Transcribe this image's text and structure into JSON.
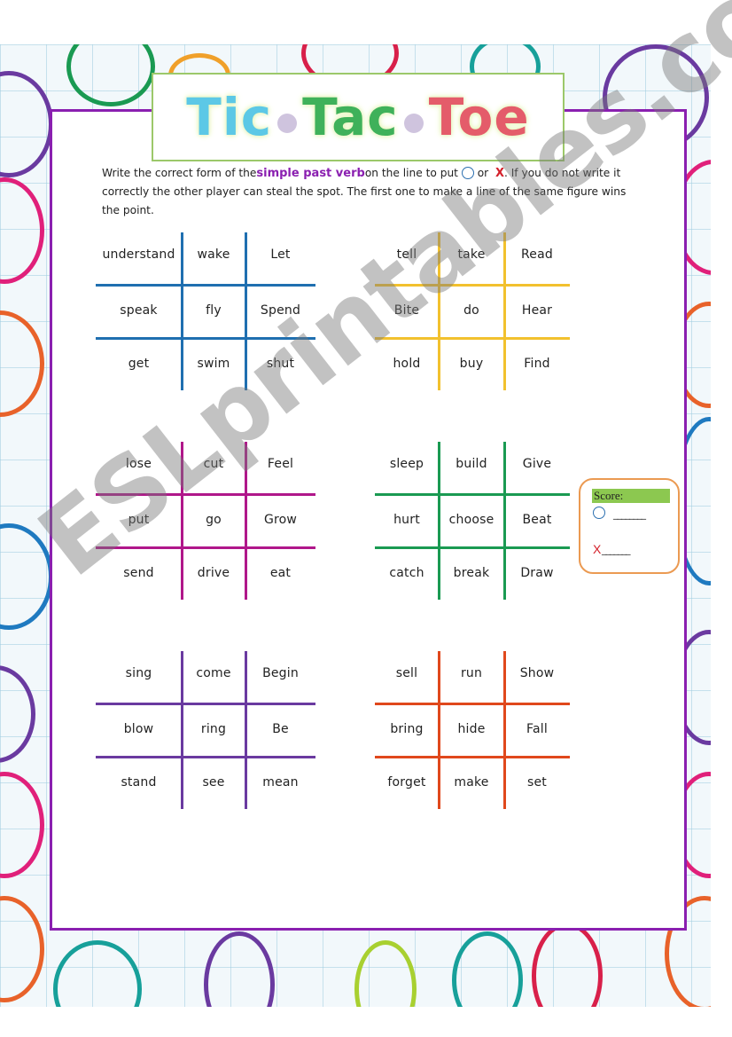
{
  "title": {
    "words": [
      "Tic",
      "Tac",
      "Toe"
    ]
  },
  "instructions": {
    "part1": "Write the correct form of the",
    "highlight": "simple past verb",
    "part2": "on the line to put",
    "or": "or",
    "x_symbol": "X",
    "part3": ". If you do not write it correctly the other player can steal the spot. The first one to make a line of the same figure wins the point."
  },
  "colors": {
    "frame": "#8a1fb0",
    "grid1": "#1f6fb0",
    "grid2": "#f2c12e",
    "grid3": "#b0178a",
    "grid4": "#1a9a52",
    "grid5": "#6a3aa0",
    "grid6": "#e0481c",
    "score_border": "#eb9a52",
    "score_label_bg": "#8cc850"
  },
  "grids": [
    {
      "name": "blue-grid",
      "cells": [
        "understand",
        "wake",
        "Let",
        "speak",
        "fly",
        "Spend",
        "get",
        "swim",
        "shut"
      ]
    },
    {
      "name": "yellow-grid",
      "cells": [
        "tell",
        "take",
        "Read",
        "Bite",
        "do",
        "Hear",
        "hold",
        "buy",
        "Find"
      ]
    },
    {
      "name": "magenta-grid",
      "cells": [
        "lose",
        "cut",
        "Feel",
        "put",
        "go",
        "Grow",
        "send",
        "drive",
        "eat"
      ]
    },
    {
      "name": "green-grid",
      "cells": [
        "sleep",
        "build",
        "Give",
        "hurt",
        "choose",
        "Beat",
        "catch",
        "break",
        "Draw"
      ]
    },
    {
      "name": "purple-grid",
      "cells": [
        "sing",
        "come",
        "Begin",
        "blow",
        "ring",
        "Be",
        "stand",
        "see",
        "mean"
      ]
    },
    {
      "name": "orange-grid",
      "cells": [
        "sell",
        "run",
        "Show",
        "bring",
        "hide",
        "Fall",
        "forget",
        "make",
        "set"
      ]
    }
  ],
  "score": {
    "label": "Score:",
    "circle_line": "________",
    "x_symbol": "X",
    "x_line": "_______"
  },
  "watermark": "ESLprintables.com"
}
